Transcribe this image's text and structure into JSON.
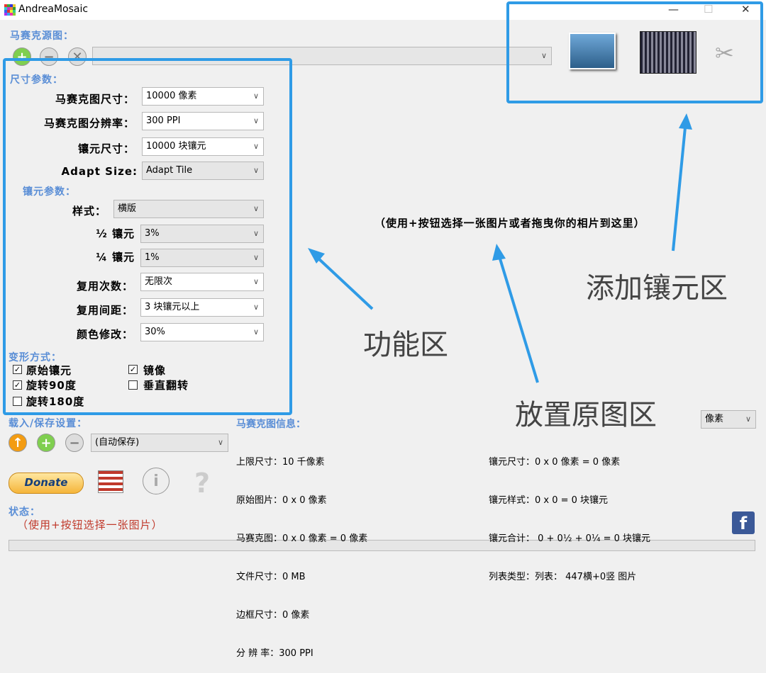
{
  "window": {
    "title": "AndreaMosaic",
    "minimize": "—",
    "maximize": "☐",
    "close": "✕"
  },
  "source": {
    "label": "马赛克源图：",
    "path_value": ""
  },
  "params": {
    "label": "尺寸参数：",
    "rows": [
      {
        "label": "马赛克图尺寸：",
        "value": "10000 像素"
      },
      {
        "label": "马赛克图分辨率：",
        "value": "300 PPI"
      },
      {
        "label": "镶元尺寸：",
        "value": "10000 块镶元"
      },
      {
        "label": "Adapt Size:",
        "value": "Adapt Tile"
      }
    ]
  },
  "tile_params": {
    "label": "镶元参数：",
    "rows": [
      {
        "label": "样式：",
        "value": "横版"
      },
      {
        "label": "½ 镶元",
        "value": "3%"
      },
      {
        "label": "¼ 镶元",
        "value": "1%"
      },
      {
        "label": "复用次数：",
        "value": "无限次"
      },
      {
        "label": "复用间距：",
        "value": "3 块镶元以上"
      },
      {
        "label": "颜色修改：",
        "value": "30%"
      }
    ]
  },
  "transform": {
    "label": "变形方式：",
    "options": [
      {
        "label": "原始镶元",
        "checked": true
      },
      {
        "label": "镜像",
        "checked": true
      },
      {
        "label": "旋转90度",
        "checked": true
      },
      {
        "label": "垂直翻转",
        "checked": false
      },
      {
        "label": "旋转180度",
        "checked": false
      }
    ]
  },
  "load_save": {
    "label": "载入/保存设置：",
    "value": "(自动保存)"
  },
  "donate": {
    "label": "Donate"
  },
  "status": {
    "label": "状态：",
    "message": "（使用+按钮选择一张图片）"
  },
  "center_hint": "（使用+按钮选择一张图片或者拖曳你的相片到这里）",
  "annotations": {
    "function_area": "功能区",
    "add_tile_area": "添加镶元区",
    "source_area": "放置原图区"
  },
  "unit_select": "像素",
  "mosaic_info": {
    "title": "马赛克图信息：",
    "lines": [
      "上限尺寸：10 千像素",
      "原始图片：0 x 0 像素",
      "马赛克图：0 x 0 像素 = 0 像素",
      "文件尺寸：0 MB",
      "边框尺寸：0 像素",
      "分 辨 率：300 PPI"
    ]
  },
  "tile_info": {
    "lines": [
      "镶元尺寸：0 x 0 像素 = 0 像素",
      "镶元样式：0 x 0 = 0 块镶元",
      "镶元合计： 0 + 0½ + 0¼ = 0 块镶元",
      "列表类型：列表： 447横+0竖 图片"
    ]
  },
  "colors": {
    "accent": "#2f9be6",
    "section": "#5a8ed6",
    "status_text": "#c0392b"
  }
}
